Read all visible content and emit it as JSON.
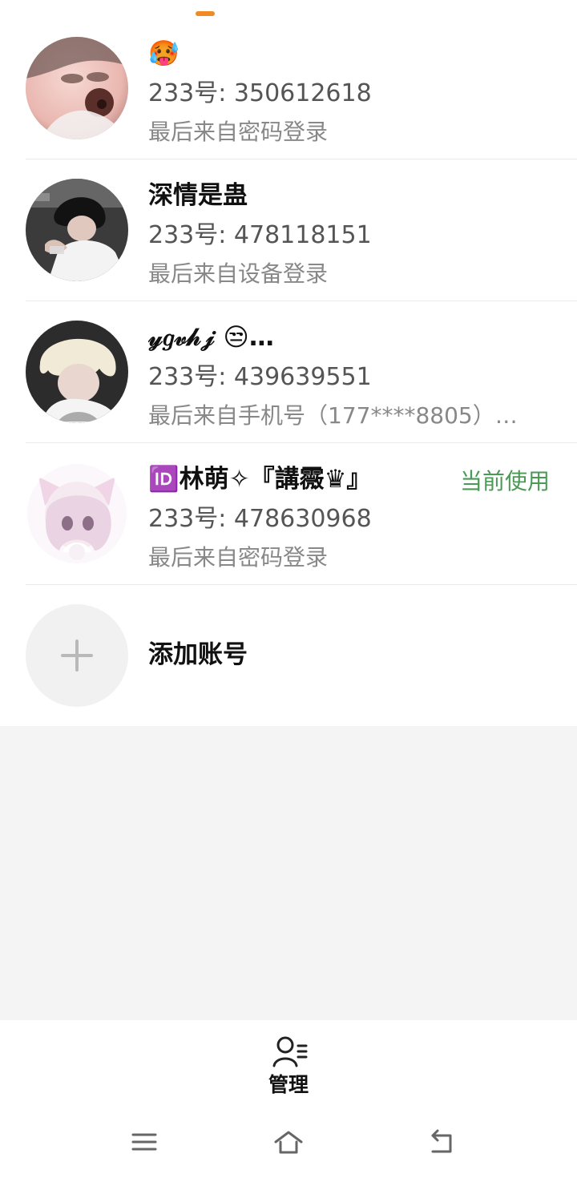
{
  "colors": {
    "accent": "#f08a24",
    "current_green": "#4a9a55"
  },
  "accounts": [
    {
      "name": "🥵",
      "id_line": "233号: 350612618",
      "login_method": "最后来自密码登录",
      "avatar": "avatar-photo-1"
    },
    {
      "name": "深情是蛊",
      "id_line": "233号: 478118151",
      "login_method": "最后来自设备登录",
      "avatar": "avatar-photo-2"
    },
    {
      "name": "𝓎𝑔𝓋𝒽𝒿 😒…",
      "id_line": "233号: 439639551",
      "login_method": "最后来自手机号（177****8805）…",
      "avatar": "avatar-photo-3"
    },
    {
      "name": "🆔林萌✧『講霺♛』",
      "id_line": "233号: 478630968",
      "login_method": "最后来自密码登录",
      "avatar": "avatar-photo-4",
      "current_label": "当前使用"
    }
  ],
  "add_account": {
    "label": "添加账号",
    "icon": "plus-icon"
  },
  "bottom_tab": {
    "label": "管理",
    "icon": "manage-icon"
  },
  "system_nav": {
    "menu_icon": "menu-icon",
    "home_icon": "home-icon",
    "back_icon": "back-icon"
  }
}
